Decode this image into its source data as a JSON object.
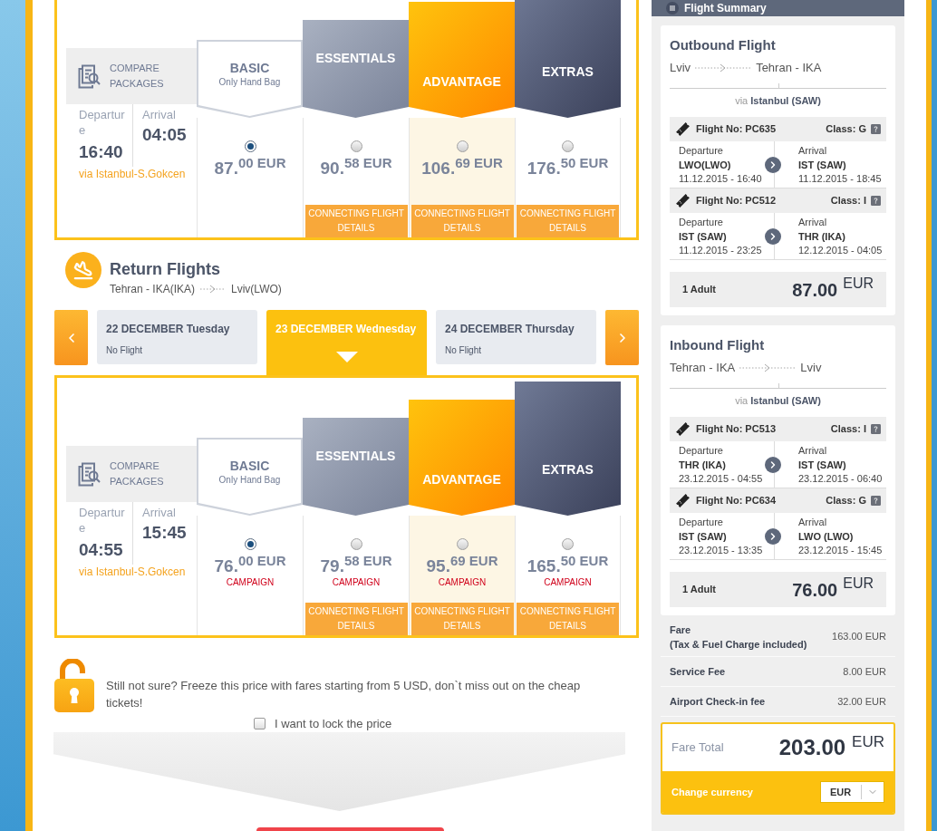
{
  "outbound_packages": {
    "compare": "COMPARE PACKAGES",
    "departure_label": "Departure",
    "departure_time": "16:40",
    "arrival_label": "Arrival",
    "arrival_time": "04:05",
    "via": "via Istanbul-S.Gokcen",
    "packages": [
      {
        "kind": "basic",
        "name": "BASIC",
        "note": "Only Hand Bag",
        "price": "87.$^{00 EUR}$",
        "selected": true
      },
      {
        "kind": "essentials",
        "name": "ESSENTIALS",
        "price": "90.$^{58 EUR}$",
        "selected": false,
        "details_button": "CONNECTING FLIGHT DETAILS"
      },
      {
        "kind": "advantage",
        "name": "ADVANTAGE",
        "price": "106.$^{69 EUR}$",
        "selected": false,
        "details_button": "CONNECTING FLIGHT DETAILS"
      },
      {
        "kind": "extras",
        "name": "EXTRAS",
        "price": "176.$^{50 EUR}$",
        "selected": false,
        "details_button": "CONNECTING FLIGHT DETAILS"
      }
    ]
  },
  "return_flights": {
    "title": "Return Flights",
    "from": "Tehran - IKA(IKA)",
    "to": "Lviv(LWO)"
  },
  "date_tabs": [
    {
      "date": "22 DECEMBER Tuesday",
      "note": "No Flight",
      "selected": false
    },
    {
      "date": "23 DECEMBER Wednesday",
      "selected": true
    },
    {
      "date": "24 DECEMBER Thursday",
      "note": "No Flight",
      "selected": false
    }
  ],
  "return_packages": {
    "compare": "COMPARE PACKAGES",
    "departure_label": "Departure",
    "departure_time": "04:55",
    "arrival_label": "Arrival",
    "arrival_time": "15:45",
    "via": "via Istanbul-S.Gokcen",
    "packages": [
      {
        "kind": "basic",
        "name": "BASIC",
        "note": "Only Hand Bag",
        "price": "76.$^{00 EUR}$",
        "tag": "CAMPAIGN",
        "selected": true
      },
      {
        "kind": "essentials",
        "name": "ESSENTIALS",
        "price": "79.$^{58 EUR}$",
        "tag": "CAMPAIGN",
        "selected": false,
        "details_button": "CONNECTING FLIGHT DETAILS"
      },
      {
        "kind": "advantage",
        "name": "ADVANTAGE",
        "price": "95.$^{69 EUR}$",
        "tag": "CAMPAIGN",
        "selected": false,
        "details_button": "CONNECTING FLIGHT DETAILS"
      },
      {
        "kind": "extras",
        "name": "EXTRAS",
        "price": "165.$^{50 EUR}$",
        "tag": "CAMPAIGN",
        "selected": false,
        "details_button": "CONNECTING FLIGHT DETAILS"
      }
    ]
  },
  "price_lock": {
    "message": "Still not sure? Freeze this price with fares starting from 5 USD, don`t miss out on the cheap tickets!",
    "checkbox": {
      "label": "I want to lock the price",
      "checked": false
    }
  },
  "flight_summary": {
    "title": "Flight Summary",
    "legs": [
      {
        "title": "Outbound Flight",
        "from": "Lviv",
        "to": "Tehran - IKA",
        "via": "via **Istanbul (SAW)**",
        "segments": [
          {
            "flight_no": "Flight No: PC635",
            "class": "Class: G",
            "departure": {
              "label": "Departure",
              "airport": "LWO(LWO)",
              "time": "11.12.2015 - 16:40"
            },
            "arrival": {
              "label": "Arrival",
              "airport": "IST (SAW)",
              "time": "11.12.2015 - 18:45"
            }
          },
          {
            "flight_no": "Flight No: PC512",
            "class": "Class: I",
            "departure": {
              "label": "Departure",
              "airport": "IST (SAW)",
              "time": "11.12.2015 - 23:25"
            },
            "arrival": {
              "label": "Arrival",
              "airport": "THR (IKA)",
              "time": "12.12.2015 - 04:05"
            }
          }
        ],
        "passengers": "1 Adult",
        "amount": "87.00",
        "currency": "EUR"
      },
      {
        "title": "Inbound Flight",
        "from": "Tehran - IKA",
        "to": "Lviv",
        "via": "via **Istanbul (SAW)**",
        "segments": [
          {
            "flight_no": "Flight No: PC513",
            "class": "Class: I",
            "departure": {
              "label": "Departure",
              "airport": "THR (IKA)",
              "time": "23.12.2015 - 04:55"
            },
            "arrival": {
              "label": "Arrival",
              "airport": "IST (SAW)",
              "time": "23.12.2015 - 06:40"
            }
          },
          {
            "flight_no": "Flight No: PC634",
            "class": "Class: G",
            "departure": {
              "label": "Departure",
              "airport": "IST (SAW)",
              "time": "23.12.2015 - 13:35"
            },
            "arrival": {
              "label": "Arrival",
              "airport": "LWO (LWO)",
              "time": "23.12.2015 - 15:45"
            }
          }
        ],
        "passengers": "1 Adult",
        "amount": "76.00",
        "currency": "EUR"
      }
    ],
    "fees": [
      {
        "label": "Fare",
        "note": "(Tax & Fuel Charge included)",
        "amount": "163.00 EUR"
      },
      {
        "label": "Service Fee",
        "amount": "8.00 EUR"
      },
      {
        "label": "Airport Check-in fee",
        "amount": "32.00 EUR"
      }
    ],
    "total": {
      "label": "Fare Total",
      "amount": "203.00",
      "currency": "EUR"
    },
    "currency": {
      "label": "Change currency",
      "value": "EUR"
    }
  }
}
